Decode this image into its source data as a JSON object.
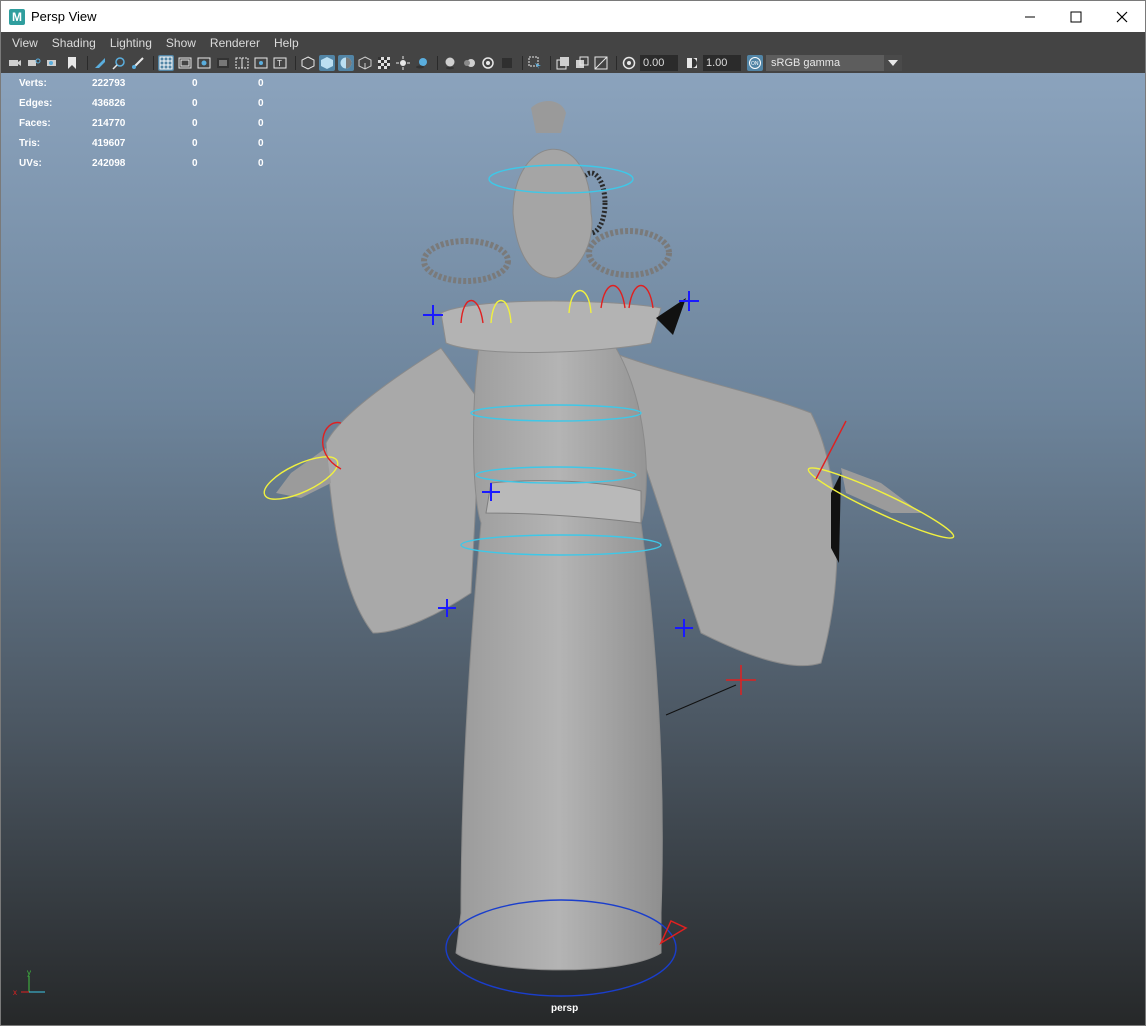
{
  "window": {
    "title": "Persp View",
    "app_icon_letter": "M",
    "controls": [
      "minimize-icon",
      "maximize-icon",
      "close-icon"
    ]
  },
  "menu": [
    "View",
    "Shading",
    "Lighting",
    "Show",
    "Renderer",
    "Help"
  ],
  "toolbar": {
    "exposure_value": "0.00",
    "gamma_value": "1.00",
    "color_space": "sRGB gamma"
  },
  "hud": {
    "rows": [
      {
        "label": "Verts:",
        "value": "222793",
        "sel": "0",
        "sel2": "0"
      },
      {
        "label": "Edges:",
        "value": "436826",
        "sel": "0",
        "sel2": "0"
      },
      {
        "label": "Faces:",
        "value": "214770",
        "sel": "0",
        "sel2": "0"
      },
      {
        "label": "Tris:",
        "value": "419607",
        "sel": "0",
        "sel2": "0"
      },
      {
        "label": "UVs:",
        "value": "242098",
        "sel": "0",
        "sel2": "0"
      }
    ]
  },
  "viewport": {
    "camera_label": "persp",
    "axis_x": "x",
    "axis_y": "y"
  },
  "colors": {
    "viewport_top": "#8ba3bd",
    "viewport_bottom": "#262829",
    "ui_dark": "#444444",
    "active_blue": "#5285a6",
    "control_cyan": "#3ec8e8",
    "control_yellow": "#f0f040",
    "control_red": "#e02020",
    "control_blue": "#1a1aff"
  }
}
